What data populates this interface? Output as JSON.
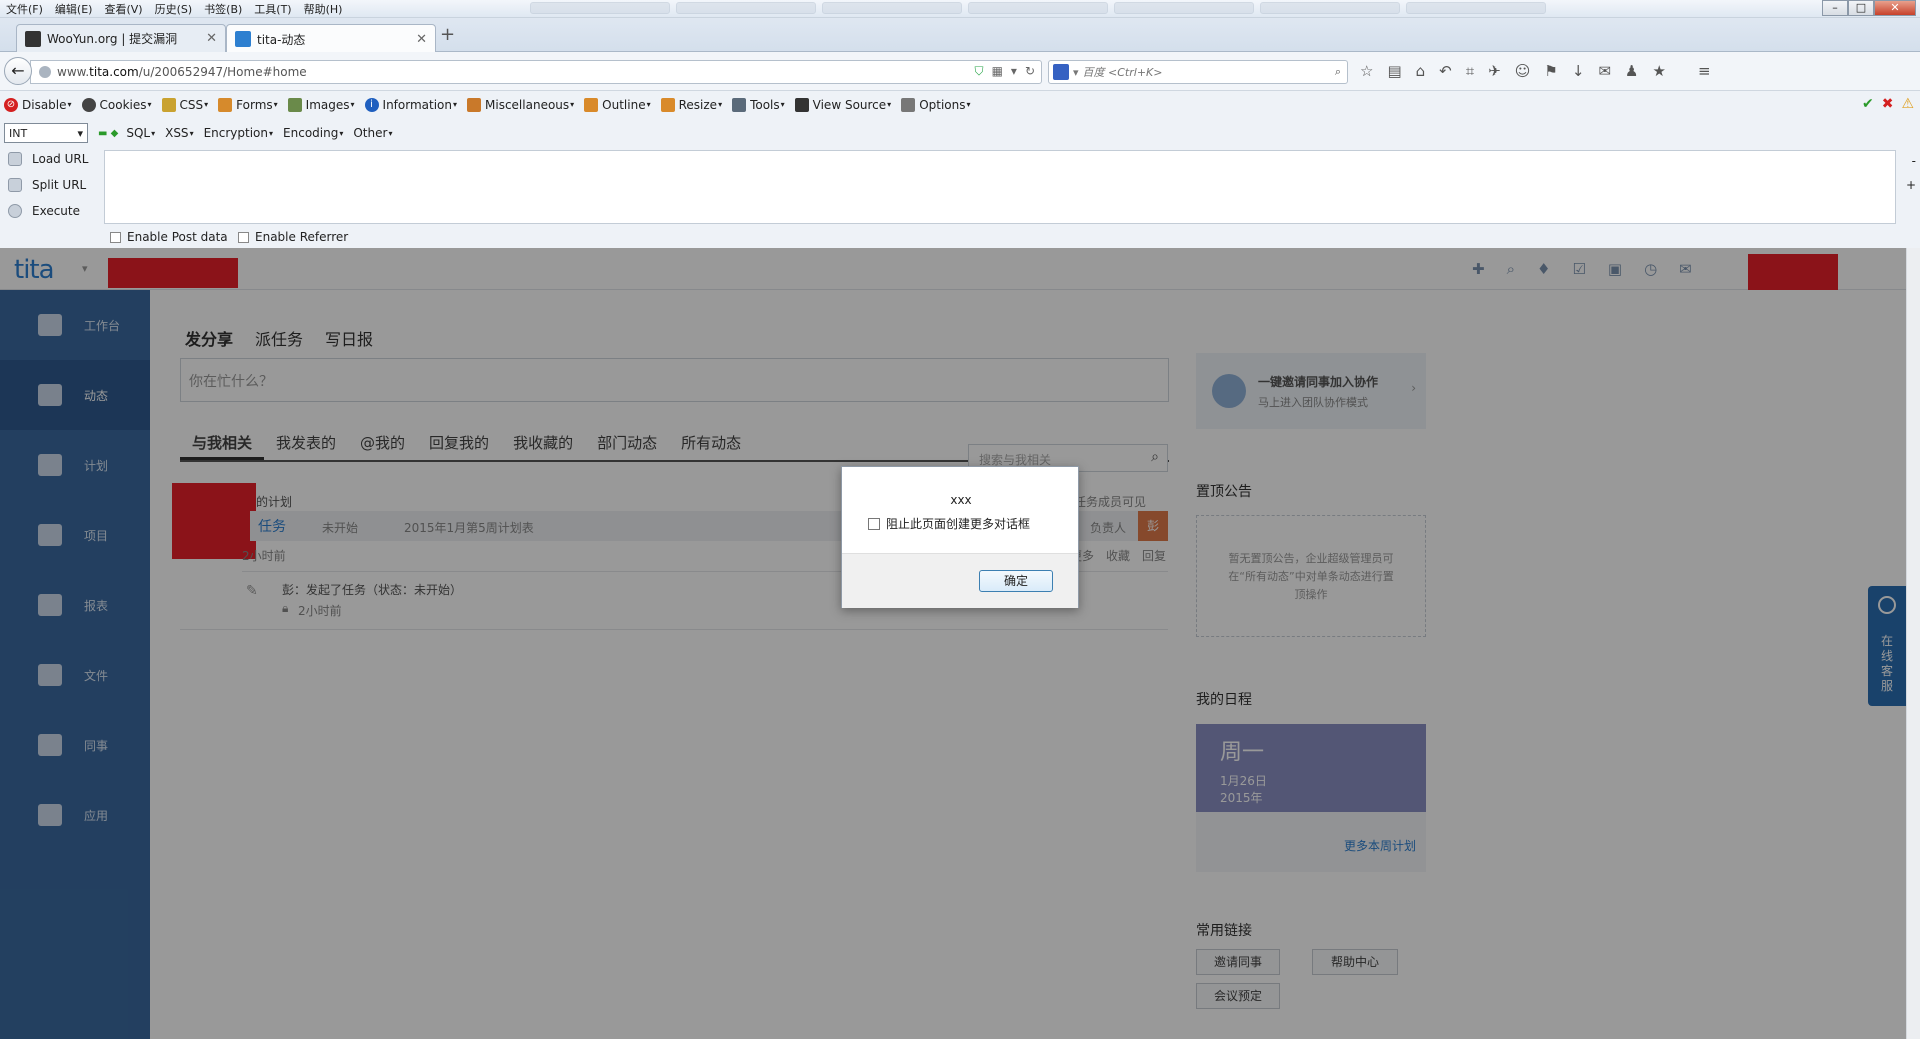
{
  "menubar": {
    "items": [
      "文件(F)",
      "编辑(E)",
      "查看(V)",
      "历史(S)",
      "书签(B)",
      "工具(T)",
      "帮助(H)"
    ]
  },
  "tabs": [
    {
      "title": "WooYun.org | 提交漏洞",
      "icon": "wooyun-favicon"
    },
    {
      "title": "tita-动态",
      "icon": "tita-favicon"
    }
  ],
  "newtab": "+",
  "nav": {
    "url_prefix": "www.",
    "url_domain": "tita.com",
    "url_path": "/u/200652947/Home#home",
    "search_placeholder": "百度 <Ctrl+K>"
  },
  "webdev_toolbar": {
    "items": [
      "Disable",
      "Cookies",
      "CSS",
      "Forms",
      "Images",
      "Information",
      "Miscellaneous",
      "Outline",
      "Resize",
      "Tools",
      "View Source",
      "Options"
    ]
  },
  "hackbar": {
    "select_value": "INT",
    "menu": [
      "SQL",
      "XSS",
      "Encryption",
      "Encoding",
      "Other"
    ],
    "buttons": [
      "Load URL",
      "Split URL",
      "Execute"
    ],
    "text_value": "",
    "enable_post": "Enable Post data",
    "enable_referrer": "Enable Referrer"
  },
  "app": {
    "logo": "tita",
    "sidebar": [
      "工作台",
      "动态",
      "计划",
      "项目",
      "报表",
      "文件",
      "同事",
      "应用"
    ],
    "sidebar_active": 1,
    "composer_tabs": [
      "发分享",
      "派任务",
      "写日报"
    ],
    "composer_placeholder": "你在忙什么？",
    "feed_tabs": [
      "与我相关",
      "我发表的",
      "@我的",
      "回复我的",
      "我收藏的",
      "部门动态",
      "所有动态"
    ],
    "feed_search_placeholder": "搜索与我相关",
    "feed": {
      "plan_label": "的计划",
      "visibility": "仅任务成员可见",
      "task_title": "任务",
      "task_status": "未开始",
      "task_plan": "2015年1月第5周计划表",
      "task_owner": "负责人",
      "owner_badge": "彭",
      "time": "2小时前",
      "actions": [
        "更多",
        "收藏",
        "回复"
      ],
      "activity": "彭：发起了任务（状态：未开始）",
      "activity_time": "2小时前"
    },
    "invite_title": "一键邀请同事加入协作",
    "invite_sub": "马上进入团队协作模式",
    "notice_title": "置顶公告",
    "notice_text": "暂无置顶公告，企业超级管理员可在“所有动态”中对单条动态进行置顶操作",
    "schedule_title": "我的日程",
    "calendar": {
      "weekday": "周一",
      "date": "1月26日",
      "year": "2015年"
    },
    "more_plans": "更多本周计划",
    "links_title": "常用链接",
    "links": [
      "邀请同事",
      "帮助中心",
      "会议预定"
    ],
    "kefu": "在线客服"
  },
  "dialog": {
    "message": "xxx",
    "checkbox_label": "阻止此页面创建更多对话框",
    "ok_label": "确定"
  }
}
